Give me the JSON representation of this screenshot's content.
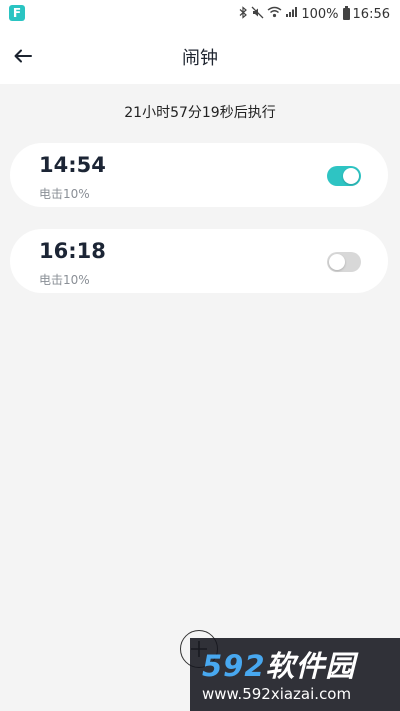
{
  "status_bar": {
    "battery_percent": "100%",
    "time": "16:56"
  },
  "header": {
    "title": "闹钟"
  },
  "countdown_text": "21小时57分19秒后执行",
  "alarms": [
    {
      "time": "14:54",
      "label": "电击10%",
      "enabled": true
    },
    {
      "time": "16:18",
      "label": "电击10%",
      "enabled": false
    }
  ],
  "watermark": {
    "logo_number": "592",
    "logo_text": "软件园",
    "url": "www.592xiazai.com"
  },
  "colors": {
    "accent": "#2ec4c3",
    "toggle_off": "#d8d8d8",
    "background": "#f4f4f4",
    "card": "#ffffff"
  }
}
